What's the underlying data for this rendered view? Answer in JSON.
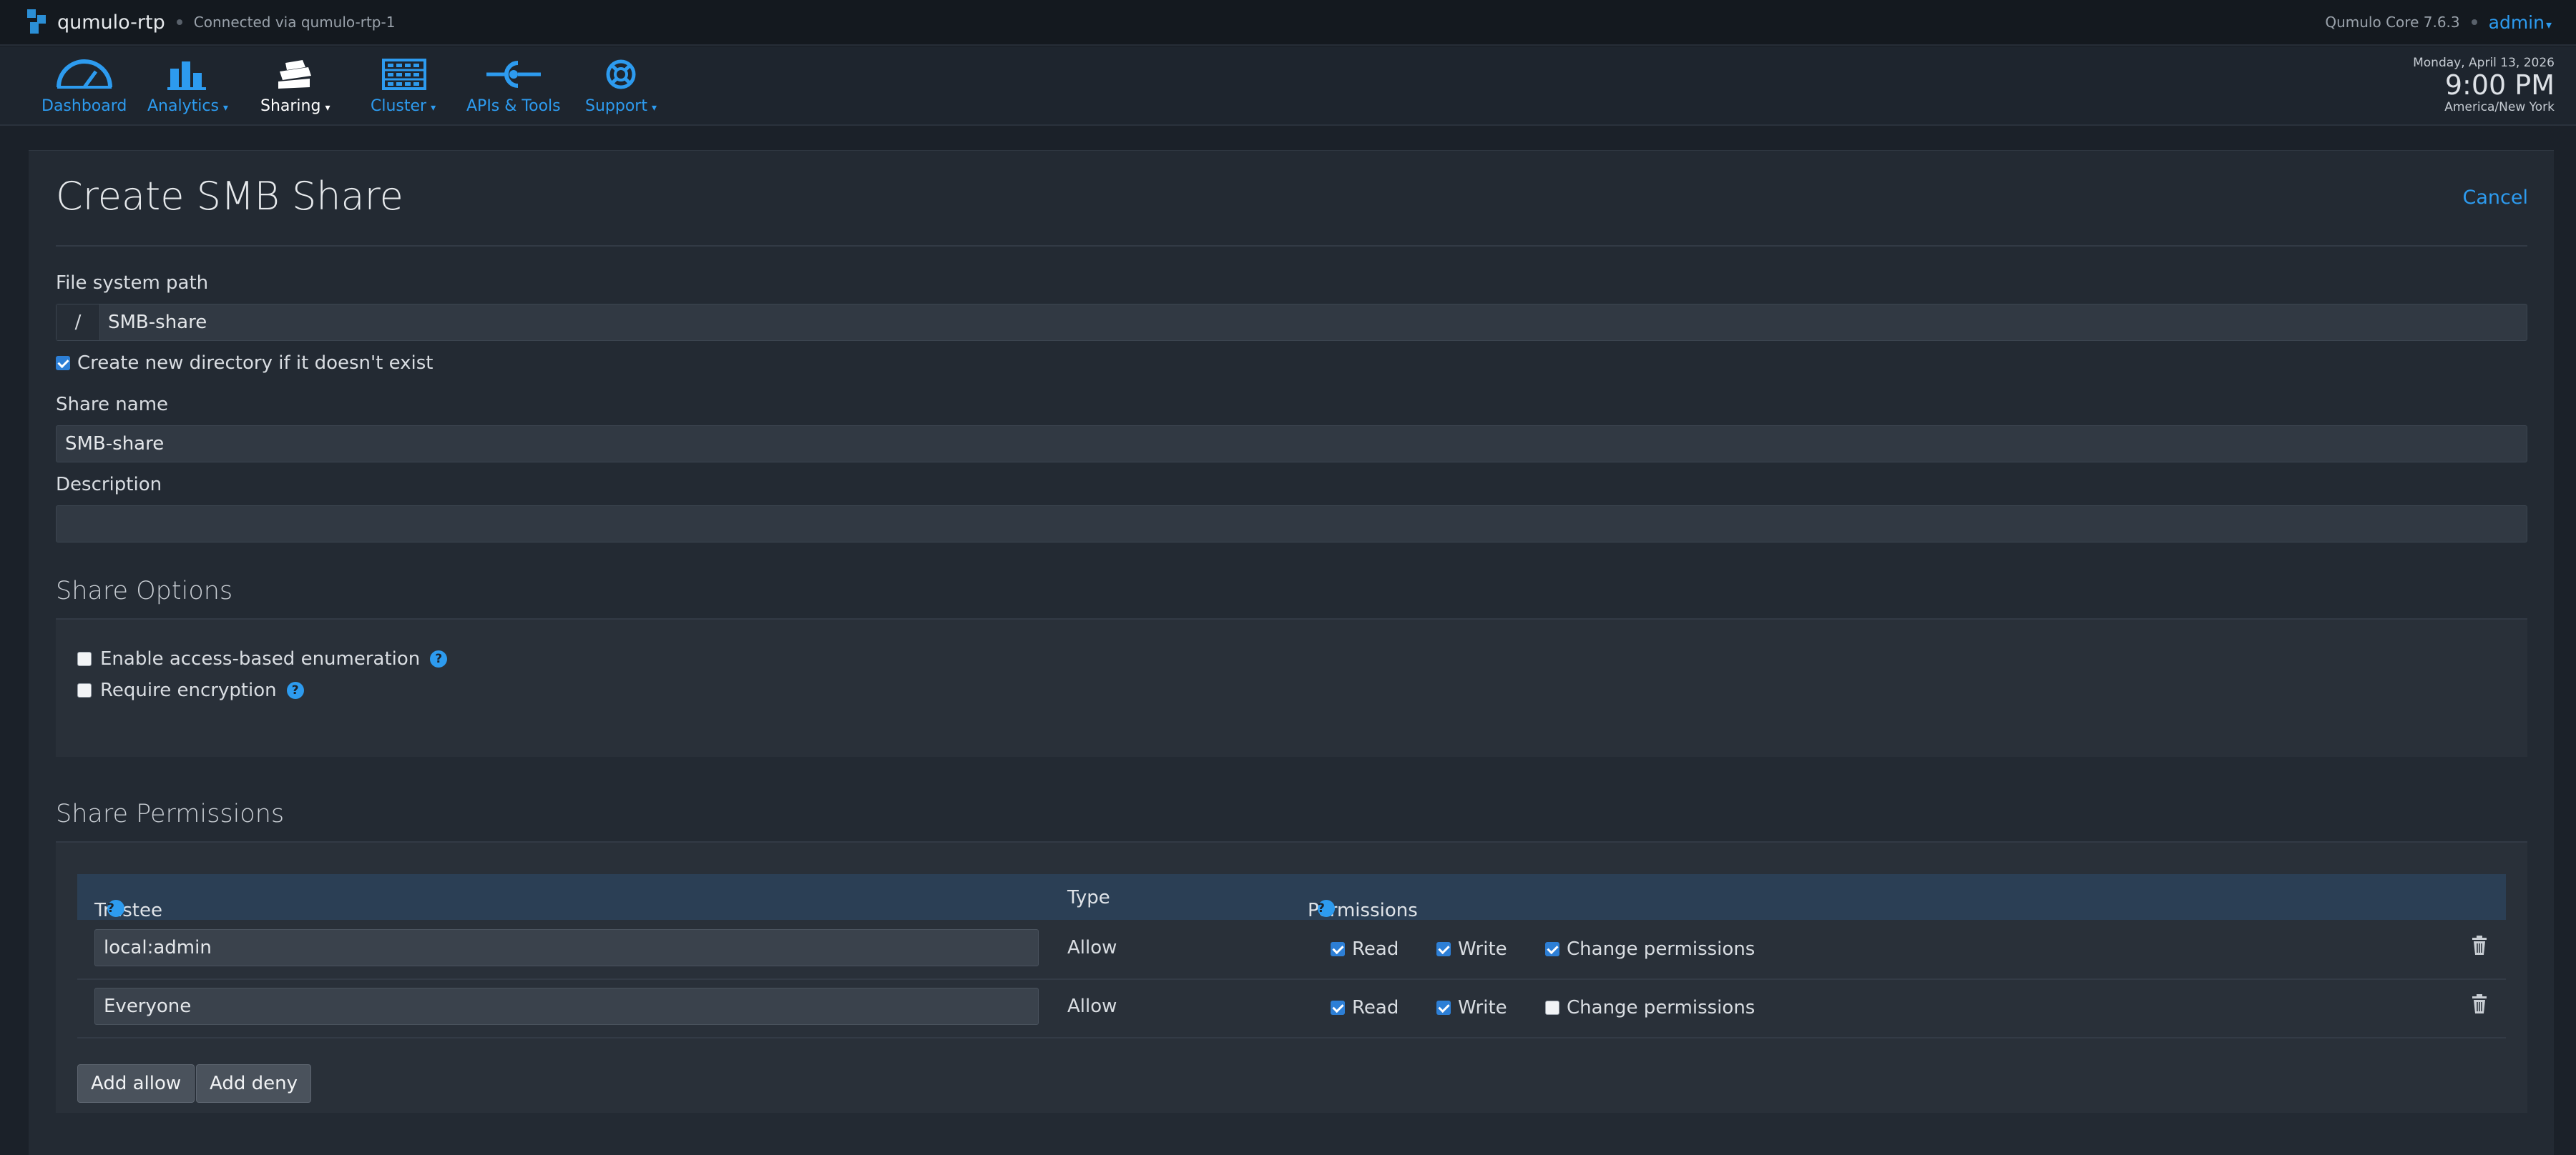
{
  "topbar": {
    "cluster_name": "qumulo-rtp",
    "connection": "Connected via qumulo-rtp-1",
    "version": "Qumulo Core 7.6.3",
    "user": "admin"
  },
  "nav": {
    "items": [
      {
        "label": "Dashboard",
        "icon": "gauge-icon",
        "dropdown": false
      },
      {
        "label": "Analytics",
        "icon": "bar-chart-icon",
        "dropdown": true
      },
      {
        "label": "Sharing",
        "icon": "hands-icon",
        "dropdown": true,
        "active": true
      },
      {
        "label": "Cluster",
        "icon": "server-rack-icon",
        "dropdown": true
      },
      {
        "label": "APIs & Tools",
        "icon": "connector-icon",
        "dropdown": false
      },
      {
        "label": "Support",
        "icon": "lifebuoy-icon",
        "dropdown": true
      }
    ],
    "caret": "▾"
  },
  "clock": {
    "date": "Monday, April 13, 2026",
    "time": "9:00 PM",
    "timezone": "America/New York"
  },
  "form": {
    "title": "Create SMB Share",
    "cancel_label": "Cancel",
    "path_label": "File system path",
    "path_prefix": "/",
    "path_value": "SMB-share",
    "create_dir_label": "Create new directory if it doesn't exist",
    "create_dir_checked": true,
    "share_name_label": "Share name",
    "share_name_value": "SMB-share",
    "description_label": "Description",
    "description_value": ""
  },
  "share_options": {
    "heading": "Share Options",
    "abe_label": "Enable access-based enumeration",
    "abe_checked": false,
    "encryption_label": "Require encryption",
    "encryption_checked": false,
    "help_glyph": "?"
  },
  "permissions": {
    "heading": "Share Permissions",
    "columns": {
      "trustee": "Trustee",
      "type": "Type",
      "permissions": "Permissions"
    },
    "perm_labels": {
      "read": "Read",
      "write": "Write",
      "change": "Change permissions"
    },
    "rows": [
      {
        "trustee": "local:admin",
        "type": "Allow",
        "read": true,
        "write": true,
        "change": true
      },
      {
        "trustee": "Everyone",
        "type": "Allow",
        "read": true,
        "write": true,
        "change": false
      }
    ],
    "add_allow_label": "Add allow",
    "add_deny_label": "Add deny"
  },
  "colors": {
    "accent": "#2d9bef",
    "background": "#1b2129",
    "panel": "#232a33",
    "checkbox": "#2d7fd6"
  }
}
